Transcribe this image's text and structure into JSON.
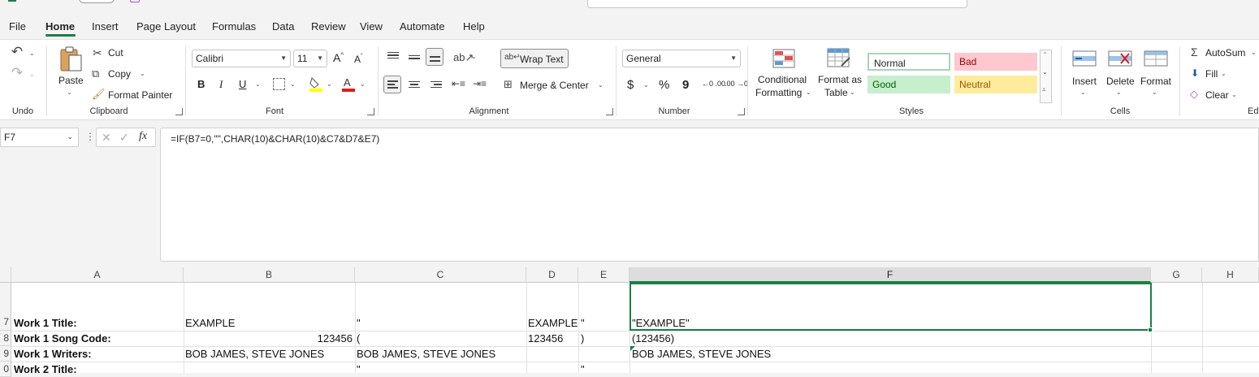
{
  "menu": {
    "items": [
      "File",
      "Home",
      "Insert",
      "Page Layout",
      "Formulas",
      "Data",
      "Review",
      "View",
      "Automate",
      "Help"
    ],
    "active": "Home"
  },
  "ribbon": {
    "undo": {
      "label": "Undo"
    },
    "clipboard": {
      "label": "Clipboard",
      "paste": "Paste",
      "cut": "Cut",
      "copy": "Copy",
      "format_painter": "Format Painter"
    },
    "font": {
      "label": "Font",
      "family": "Calibri",
      "size": "11",
      "bold": "B",
      "italic": "I",
      "underline": "U"
    },
    "alignment": {
      "label": "Alignment",
      "wrap_text": "Wrap Text",
      "merge_center": "Merge & Center"
    },
    "number": {
      "label": "Number",
      "format": "General",
      "currency": "$",
      "percent": "%",
      "comma": "9",
      "inc_dec": "←0 .00",
      "dec_dec": ".00 →0"
    },
    "styles": {
      "label": "Styles",
      "conditional_formatting_1": "Conditional",
      "conditional_formatting_2": "Formatting",
      "format_as_table_1": "Format as",
      "format_as_table_2": "Table",
      "normal": "Normal",
      "bad": "Bad",
      "good": "Good",
      "neutral": "Neutral",
      "colors": {
        "bad_bg": "#ffc7ce",
        "bad_fg": "#9c0006",
        "good_bg": "#c6efce",
        "good_fg": "#006100",
        "neutral_bg": "#ffeb9c",
        "neutral_fg": "#9c5700"
      }
    },
    "cells": {
      "label": "Cells",
      "insert": "Insert",
      "delete": "Delete",
      "format": "Format"
    },
    "editing": {
      "label": "Ed",
      "autosum": "AutoSum",
      "fill": "Fill",
      "clear": "Clear"
    }
  },
  "formula_bar": {
    "name_box": "F7",
    "fx": "fx",
    "formula": "=IF(B7=0,\"\",CHAR(10)&CHAR(10)&C7&D7&E7)"
  },
  "grid": {
    "columns": [
      "A",
      "B",
      "C",
      "D",
      "E",
      "F",
      "G",
      "H"
    ],
    "selected_column": "F",
    "rows": [
      {
        "num": "7",
        "A": "Work 1 Title:",
        "B": "EXAMPLE",
        "C": "\"",
        "D": "EXAMPLE",
        "E": "\"",
        "F": "\"EXAMPLE\""
      },
      {
        "num": "8",
        "A": "Work 1 Song Code:",
        "B": "123456",
        "C": "(",
        "D": "123456",
        "E": ")",
        "F": "(123456)"
      },
      {
        "num": "9",
        "A": "Work 1 Writers:",
        "B": "BOB JAMES, STEVE JONES",
        "C": "BOB JAMES, STEVE JONES",
        "D": "",
        "E": "",
        "F": "BOB JAMES, STEVE JONES"
      },
      {
        "num": "0",
        "A": "Work 2 Title:",
        "B": "",
        "C": "\"",
        "D": "",
        "E": "\"",
        "F": ""
      }
    ],
    "accent_color": "#1a7f43"
  }
}
